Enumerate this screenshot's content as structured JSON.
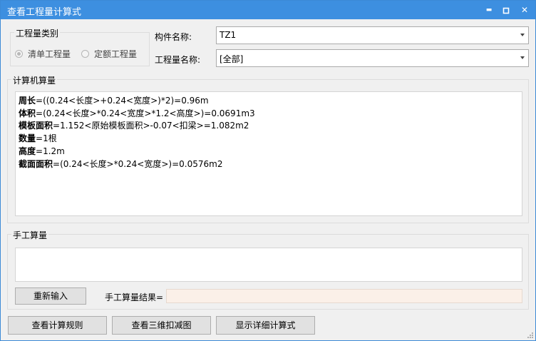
{
  "window": {
    "title": "查看工程量计算式",
    "min_glyph": "▬",
    "max_glyph": "▫",
    "close_glyph": "✕"
  },
  "category": {
    "title": "工程量类别",
    "options": [
      {
        "label": "清单工程量",
        "selected": true
      },
      {
        "label": "定额工程量",
        "selected": false
      }
    ]
  },
  "component": {
    "label": "构件名称:",
    "value": "TZ1"
  },
  "quantity_name": {
    "label": "工程量名称:",
    "value": "[全部]"
  },
  "computer_calc": {
    "title": "计算机算量",
    "lines": [
      {
        "name": "周长",
        "expr": "=((0.24<长度>+0.24<宽度>)*2)=0.96m"
      },
      {
        "name": "体积",
        "expr": "=(0.24<长度>*0.24<宽度>*1.2<高度>)=0.0691m3"
      },
      {
        "name": "模板面积",
        "expr": "=1.152<原始模板面积>-0.07<扣梁>=1.082m2"
      },
      {
        "name": "数量",
        "expr": "=1根"
      },
      {
        "name": "高度",
        "expr": "=1.2m"
      },
      {
        "name": "截面面积",
        "expr": "=(0.24<长度>*0.24<宽度>)=0.0576m2"
      }
    ]
  },
  "manual_calc": {
    "title": "手工算量",
    "reenter_label": "重新输入",
    "result_label": "手工算量结果=",
    "result_value": ""
  },
  "footer": {
    "rules_label": "查看计算规则",
    "view3d_label": "查看三维扣减图",
    "detail_label": "显示详细计算式"
  },
  "colors": {
    "titlebar": "#3d8fe0",
    "window_bg": "#f0f0f0",
    "result_bg": "#fbf0e8"
  }
}
